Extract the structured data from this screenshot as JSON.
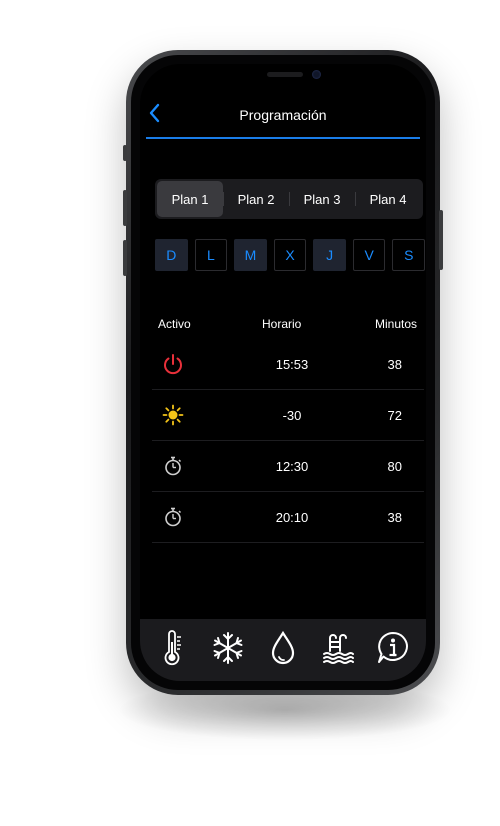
{
  "header": {
    "title": "Programación"
  },
  "plans": [
    "Plan 1",
    "Plan 2",
    "Plan 3",
    "Plan 4"
  ],
  "active_plan_index": 0,
  "days": [
    {
      "label": "D",
      "selected": true
    },
    {
      "label": "L",
      "selected": false
    },
    {
      "label": "M",
      "selected": true
    },
    {
      "label": "X",
      "selected": false
    },
    {
      "label": "J",
      "selected": true
    },
    {
      "label": "V",
      "selected": false
    },
    {
      "label": "S",
      "selected": false
    }
  ],
  "table": {
    "headers": {
      "activo": "Activo",
      "horario": "Horario",
      "minutos": "Minutos"
    },
    "rows": [
      {
        "icon": "power-icon",
        "horario": "15:53",
        "minutos": "38"
      },
      {
        "icon": "sun-icon",
        "horario": "-30",
        "minutos": "72"
      },
      {
        "icon": "timer-icon",
        "horario": "12:30",
        "minutos": "80"
      },
      {
        "icon": "timer-icon",
        "horario": "20:10",
        "minutos": "38"
      }
    ]
  },
  "tabbar": [
    "thermometer-icon",
    "snowflake-icon",
    "water-drop-icon",
    "pool-ladder-icon",
    "info-icon"
  ],
  "colors": {
    "accent": "#1a8cff",
    "power": "#e8303a",
    "sun": "#f5c518",
    "background": "#000000",
    "tabbar": "#1b1b1e"
  }
}
